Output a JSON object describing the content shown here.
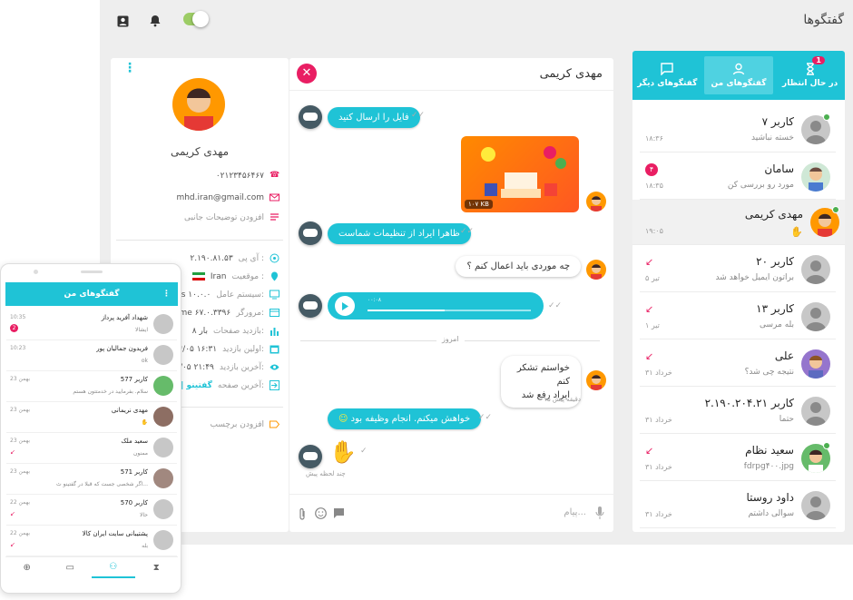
{
  "topbar": {
    "title": "گفتگوها"
  },
  "tabs": [
    {
      "label": "در حال انتظار",
      "count": "1"
    },
    {
      "label": "گفتگوهای من"
    },
    {
      "label": "گفتگوهای دیگر"
    }
  ],
  "conversations": [
    {
      "name": "کاربر ۷",
      "msg": "خسته نباشید",
      "time": "۱۸:۳۶"
    },
    {
      "name": "سامان",
      "msg": "مورد رو بررسی کن",
      "time": "۱۸:۳۵",
      "badge": "۴"
    },
    {
      "name": "مهدی کریمی",
      "msg": "",
      "time": "۱۹:۰۵"
    },
    {
      "name": "کاربر ۲۰",
      "msg": "براتون ایمیل خواهد شد",
      "time": "۵ تیر"
    },
    {
      "name": "کاربر ۱۳",
      "msg": "بله مرسی",
      "time": "۱ تیر"
    },
    {
      "name": "علی",
      "msg": "نتیجه چی شد؟",
      "time": "۳۱ خرداد"
    },
    {
      "name": "کاربر ۲.۱۹۰.۲۰۴.۲۱",
      "msg": "حتما",
      "time": "۳۱ خرداد"
    },
    {
      "name": "سعید نظام",
      "msg": "fdrpg۴۰۰.jpg",
      "time": "۳۱ خرداد"
    },
    {
      "name": "داود روستا",
      "msg": "سوالی داشتم",
      "time": "۳۱ خرداد"
    }
  ],
  "chat": {
    "contact": "مهدی کریمی",
    "msg1": "فایل را ارسال کنید",
    "file_size": "۱۰۷ KB",
    "msg2": "ظاهرا ایراد از تنظیمات شماست",
    "msg3": "چه موردی باید اعمال کنم ؟",
    "audio_time": "۰۰:۰۸",
    "day_sep": "امروز",
    "msg4_line1": "خواستم تشکر کنم",
    "msg4_line2": "ایراد رفع شد",
    "msg4_time": "۱۵ دقیقه پیش",
    "msg5": "خواهش میکنم. انجام وظیفه بود",
    "msg6_time": "چند لحظه پیش",
    "input_placeholder": "پیام..."
  },
  "profile": {
    "name": "مهدی کریمی",
    "phone": "۰۲۱۲۳۴۵۶۴۶۷",
    "email": "mhd.iran@gmail.com",
    "note_placeholder": "افزودن توضیحات جانبی",
    "ip_label": "آی پی :",
    "ip": "۲.۱۹۰.۸۱.۵۳",
    "location_label": "موقعیت :",
    "location": "Iran",
    "os_label": "سیستم عامل:",
    "os": "ws ۱۰.۰.۰",
    "browser_label": "مرورگر:",
    "browser": "rome ۶۷.۰.۳۳۹۶",
    "pages_label": "بازدید صفحات:",
    "pages": "۸ بار",
    "first_visit_label": "اولین بازدید:",
    "first_visit": "۴/۰۵ ۱۶:۳۱",
    "last_visit_label": "آخرین بازدید:",
    "last_visit": "۴/۰۵ ۲۱:۴۹",
    "last_page_label": "آخرین صفحه:",
    "last_page": "گفتینو | ثب",
    "tag_placeholder": "افزودن برچسب"
  },
  "mobile": {
    "title": "گفتگوهای من",
    "rows": [
      {
        "name": "شهداد آفرید پرداز",
        "msg": "ایشالا",
        "time": "10:35",
        "badge": "2"
      },
      {
        "name": "فریدون جمالیان پور",
        "msg": "ok",
        "time": "10:23"
      },
      {
        "name": "کاربر 577",
        "msg": "سلام. بفرمایید در خدمتتون هستم",
        "time": "23 بهمن"
      },
      {
        "name": "مهدی نریمانی",
        "msg": "",
        "time": "23 بهمن"
      },
      {
        "name": "سعید ملک",
        "msg": "ممنون",
        "time": "23 بهمن"
      },
      {
        "name": "کاربر 571",
        "msg": "اگر شخصی جست که قبلا در گفتینو ث...",
        "time": "23 بهمن"
      },
      {
        "name": "کاربر 570",
        "msg": "حالا",
        "time": "22 بهمن"
      },
      {
        "name": "پشتیبانی سایت ایران کالا",
        "msg": "بله",
        "time": "22 بهمن"
      }
    ]
  },
  "colors": {
    "accent": "#1fc3d6",
    "pink": "#e91e63",
    "green": "#4caf50"
  }
}
